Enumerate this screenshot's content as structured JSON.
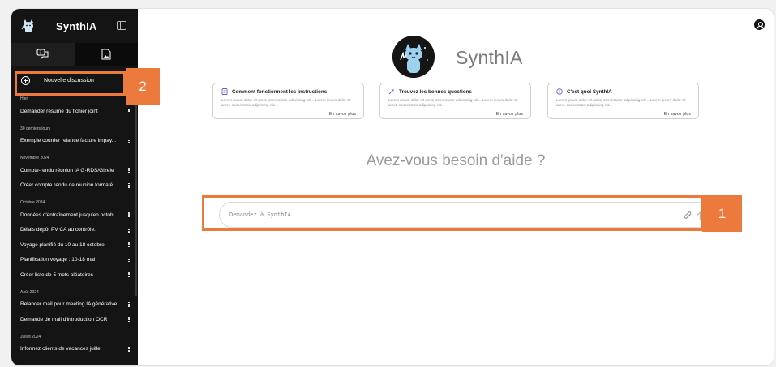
{
  "sidebar": {
    "app_title": "SynthIA",
    "new_chat_label": "Nouvelle discussion",
    "sections": [
      {
        "label": "Hier",
        "items": [
          "Demander résumé du fichier joint"
        ]
      },
      {
        "label": "30 derniers jours",
        "items": [
          "Exemple courrier relance facture impay..."
        ]
      },
      {
        "label": "Novembre 2024",
        "items": [
          "Compte-rendu réunion IA G-RDS/Gizele",
          "Créer compte rendu de réunion formaté"
        ]
      },
      {
        "label": "Octobre 2024",
        "items": [
          "Données d'entraînement jusqu'en octob...",
          "Délais dépôt PV CA au contrôle.",
          "Voyage planifié du 10 au 18 octobre",
          "Planification voyage : 10-18 mai",
          "Créer liste de 5 mots aléatoires"
        ]
      },
      {
        "label": "Août 2024",
        "items": [
          "Relancer mail pour meeting IA générative",
          "Demande de mail d'introduction OCR"
        ]
      },
      {
        "label": "Juillet 2024",
        "items": [
          "Informez clients de vacances juillet"
        ]
      }
    ]
  },
  "main": {
    "brand_name": "SynthIA",
    "cards": [
      {
        "title": "Comment fonctionnent les instructions",
        "desc": "Lorem ipsum dolor sit amet, consectetur adipiscing elit... Lorem ipsum dolor sit amet, consectetur adipiscing elit...",
        "link": "En savoir plus",
        "icon": "document-icon"
      },
      {
        "title": "Trouvez les bonnes questions",
        "desc": "Lorem ipsum dolor sit amet, consectetur adipiscing elit... Lorem ipsum dolor sit amet, consectetur adipiscing elit...",
        "link": "En savoir plus",
        "icon": "magic-wand-icon"
      },
      {
        "title": "C'est quoi SynthIA",
        "desc": "Lorem ipsum dolor sit amet, consectetur adipiscing elit... Lorem ipsum dolor sit amet, consectetur adipiscing elit...",
        "link": "En savoir plus",
        "icon": "info-icon"
      }
    ],
    "help_text": "Avez-vous besoin d'aide ?",
    "input_placeholder": "Demandez à SynthIA..."
  },
  "annotations": {
    "badge_1": "1",
    "badge_2": "2",
    "color": "#ec7a3c"
  },
  "colors": {
    "sidebar_bg": "#141414",
    "accent": "#ec7a3c",
    "card_icon": "#6b5bd6"
  }
}
